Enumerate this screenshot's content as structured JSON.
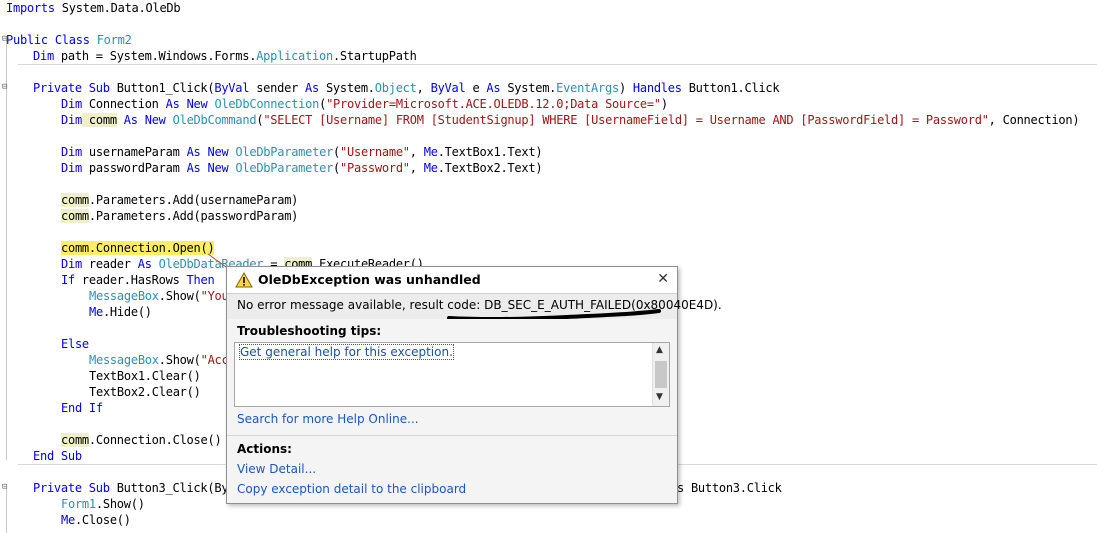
{
  "code": {
    "l1": {
      "kw": "Imports",
      "rest": " System.Data.OleDb"
    },
    "l2": {
      "kw1": "Public",
      "kw2": " Class",
      "ty": " Form2"
    },
    "l3": {
      "kw": "Dim",
      "a": " path = System.Windows.Forms.",
      "ty": "Application",
      "b": ".StartupPath"
    },
    "l4": {
      "k1": "Private",
      "k2": " Sub",
      "a": " Button1_Click(",
      "k3": "ByVal",
      "b": " sender ",
      "k4": "As",
      "c": " System.",
      "t1": "Object",
      "d": ", ",
      "k5": "ByVal",
      "e": " e ",
      "k6": "As",
      "f": " System.",
      "t2": "EventArgs",
      "g": ") ",
      "k7": "Handles",
      "h": " Button1.Click"
    },
    "l5": {
      "kw": "Dim",
      "a": " Connection ",
      "k2": "As",
      "k3": " New",
      "ty": " OleDbConnection",
      "b": "(",
      "s": "\"Provider=Microsoft.ACE.OLEDB.12.0;Data Source=\"",
      "c": ")"
    },
    "l6": {
      "kw": "Dim",
      "hv": " comm",
      "k2": " As",
      "k3": " New",
      "ty": " OleDbCommand",
      "b": "(",
      "s": "\"SELECT [Username] FROM [StudentSignup] WHERE [UsernameField] = Username AND [PasswordField] = Password\"",
      "c": ", Connection)"
    },
    "l7": {
      "kw": "Dim",
      "a": " usernameParam ",
      "k2": "As",
      "k3": " New",
      "ty": " OleDbParameter",
      "b": "(",
      "s": "\"Username\"",
      "c": ", ",
      "me": "Me",
      "d": ".TextBox1.Text)"
    },
    "l8": {
      "kw": "Dim",
      "a": " passwordParam ",
      "k2": "As",
      "k3": " New",
      "ty": " OleDbParameter",
      "b": "(",
      "s": "\"Password\"",
      "c": ", ",
      "me": "Me",
      "d": ".TextBox2.Text)"
    },
    "l9": {
      "h": "comm",
      "a": ".Parameters.Add(usernameParam)"
    },
    "l10": {
      "h": "comm",
      "a": ".Parameters.Add(passwordParam)"
    },
    "l11": {
      "h": "comm.Connection.Open()"
    },
    "l12": {
      "kw": "Dim",
      "a": " reader ",
      "k2": "As",
      "ty": " OleDbDataReader",
      "b": " = ",
      "h": "comm",
      "c": ".ExecuteReader()"
    },
    "l13": {
      "kw": "If",
      "a": " reader.HasRows ",
      "k2": "Then"
    },
    "l14": {
      "ty": "MessageBox",
      "a": ".Show(",
      "s": "\"You"
    },
    "l15": {
      "kw": "Me",
      "a": ".Hide()"
    },
    "l16": {
      "kw": "Else"
    },
    "l17": {
      "ty": "MessageBox",
      "a": ".Show(",
      "s": "\"Acc"
    },
    "l18": {
      "a": "TextBox1.Clear()"
    },
    "l19": {
      "a": "TextBox2.Clear()"
    },
    "l20": {
      "kw1": "End",
      "kw2": " If"
    },
    "l21": {
      "h": "comm",
      "a": ".Connection.Close()"
    },
    "l22": {
      "kw1": "End",
      "kw2": " Sub"
    },
    "l23": {
      "k1": "Private",
      "k2": " Sub",
      "a": " Button3_Click(By"
    },
    "l23r": {
      "a": "s Button3.Click"
    },
    "l24": {
      "ty": "Form1",
      "a": ".Show()"
    },
    "l25": {
      "kw": "Me",
      "a": ".Close()"
    }
  },
  "exception": {
    "title": "OleDbException was unhandled",
    "message": "No error message available, result code: DB_SEC_E_AUTH_FAILED(0x80040E4D).",
    "tips_header": "Troubleshooting tips:",
    "tips_link": "Get general help for this exception.",
    "search_link": "Search for more Help Online...",
    "actions_header": "Actions:",
    "view_detail": "View Detail...",
    "copy_detail": "Copy exception detail to the clipboard",
    "close_icon": "close-icon",
    "warning_icon": "warning-icon"
  },
  "colors": {
    "keyword": "#0000ff",
    "type": "#2b91af",
    "string": "#a31515",
    "link": "#1a56c8"
  }
}
